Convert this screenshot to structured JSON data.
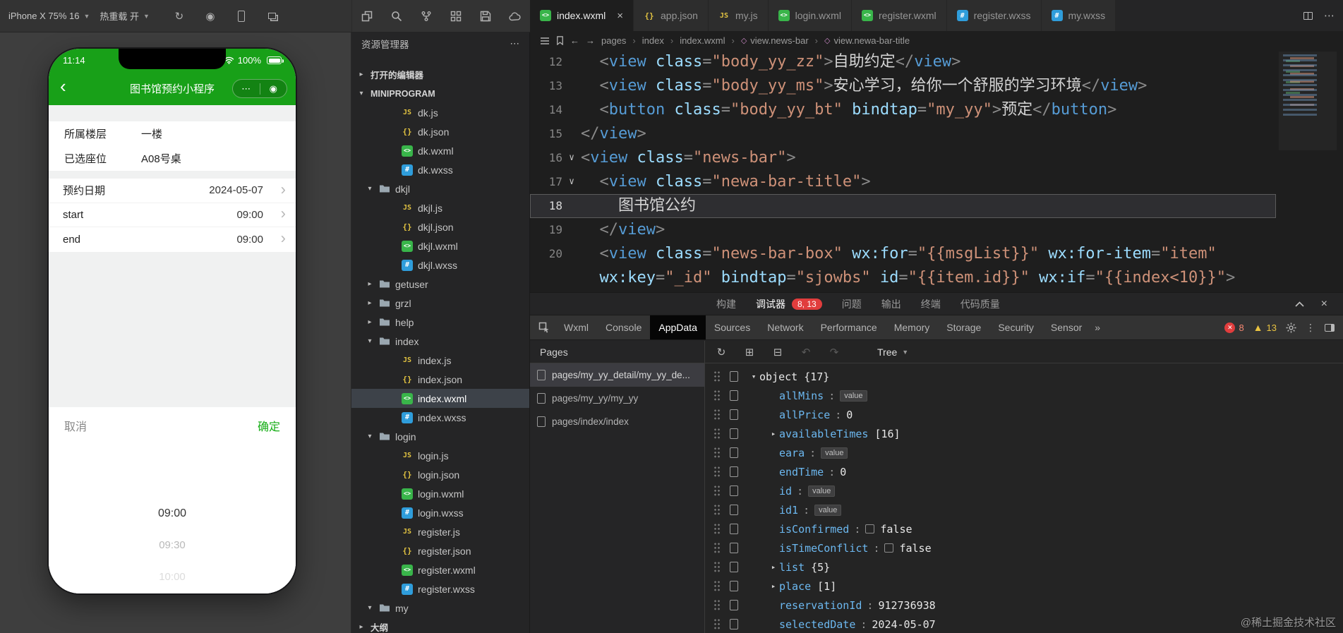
{
  "titlebar": {
    "device": "iPhone X 75% 16",
    "hot_reload": "热重载 开",
    "sim_icons": [
      "restart-icon",
      "record-icon",
      "phone-icon",
      "multi-window-icon"
    ],
    "explorer_icons": [
      "panels-icon",
      "search-icon",
      "branch-icon",
      "grid-icon",
      "save-icon",
      "cloud-icon"
    ]
  },
  "simulator": {
    "status": {
      "time": "11:14",
      "battery": "100%"
    },
    "nav_title": "图书馆预约小程序",
    "info_rows": [
      {
        "label": "所属楼层",
        "value": "一楼"
      },
      {
        "label": "已选座位",
        "value": "A08号桌"
      }
    ],
    "detail_rows": [
      {
        "label": "预约日期",
        "value": "2024-05-07"
      },
      {
        "label": "start",
        "value": "09:00"
      },
      {
        "label": "end",
        "value": "09:00"
      }
    ],
    "cancel_label": "取消",
    "confirm_label": "确定",
    "picker_options": [
      {
        "label": "09:00",
        "state": "selected"
      },
      {
        "label": "09:30",
        "state": "dim"
      },
      {
        "label": "10:00",
        "state": "faint"
      }
    ]
  },
  "explorer": {
    "title": "资源管理器",
    "items": [
      {
        "label": "打开的编辑器",
        "kind": "section",
        "arrow": "right"
      },
      {
        "label": "MINIPROGRAM",
        "kind": "section",
        "arrow": "down"
      },
      {
        "label": "dk.js",
        "kind": "js"
      },
      {
        "label": "dk.json",
        "kind": "json"
      },
      {
        "label": "dk.wxml",
        "kind": "wxml"
      },
      {
        "label": "dk.wxss",
        "kind": "wxss"
      },
      {
        "label": "dkjl",
        "kind": "folder",
        "arrow": "down"
      },
      {
        "label": "dkjl.js",
        "kind": "js"
      },
      {
        "label": "dkjl.json",
        "kind": "json"
      },
      {
        "label": "dkjl.wxml",
        "kind": "wxml"
      },
      {
        "label": "dkjl.wxss",
        "kind": "wxss"
      },
      {
        "label": "getuser",
        "kind": "folder",
        "arrow": "right"
      },
      {
        "label": "grzl",
        "kind": "folder",
        "arrow": "right"
      },
      {
        "label": "help",
        "kind": "folder",
        "arrow": "right"
      },
      {
        "label": "index",
        "kind": "folder",
        "arrow": "down"
      },
      {
        "label": "index.js",
        "kind": "js"
      },
      {
        "label": "index.json",
        "kind": "json"
      },
      {
        "label": "index.wxml",
        "kind": "wxml",
        "selected": true
      },
      {
        "label": "index.wxss",
        "kind": "wxss"
      },
      {
        "label": "login",
        "kind": "folder",
        "arrow": "down"
      },
      {
        "label": "login.js",
        "kind": "js"
      },
      {
        "label": "login.json",
        "kind": "json"
      },
      {
        "label": "login.wxml",
        "kind": "wxml"
      },
      {
        "label": "login.wxss",
        "kind": "wxss"
      },
      {
        "label": "register.js",
        "kind": "js"
      },
      {
        "label": "register.json",
        "kind": "json"
      },
      {
        "label": "register.wxml",
        "kind": "wxml"
      },
      {
        "label": "register.wxss",
        "kind": "wxss"
      },
      {
        "label": "my",
        "kind": "folder",
        "arrow": "down"
      },
      {
        "label": "大纲",
        "kind": "section",
        "arrow": "right"
      }
    ]
  },
  "editor": {
    "tabs": [
      {
        "label": "index.wxml",
        "kind": "wxml",
        "active": true
      },
      {
        "label": "app.json",
        "kind": "json"
      },
      {
        "label": "my.js",
        "kind": "js"
      },
      {
        "label": "login.wxml",
        "kind": "wxml"
      },
      {
        "label": "register.wxml",
        "kind": "wxml"
      },
      {
        "label": "register.wxss",
        "kind": "wxss"
      },
      {
        "label": "my.wxss",
        "kind": "wxss"
      }
    ],
    "breadcrumb": [
      {
        "label": "pages"
      },
      {
        "label": "index"
      },
      {
        "label": "index.wxml"
      },
      {
        "label": "view.news-bar",
        "sym": true
      },
      {
        "label": "view.newa-bar-title",
        "sym": true
      }
    ],
    "code": {
      "lines": [
        {
          "no": "12",
          "tokens": [
            {
              "c": "p",
              "t": "  <"
            },
            {
              "c": "tag",
              "t": "view"
            },
            {
              "c": "p",
              "t": " "
            },
            {
              "c": "attr",
              "t": "class"
            },
            {
              "c": "p",
              "t": "="
            },
            {
              "c": "str",
              "t": "\"body_yy_zz\""
            },
            {
              "c": "p",
              "t": ">"
            },
            {
              "c": "txt",
              "t": "自助约定"
            },
            {
              "c": "p",
              "t": "</"
            },
            {
              "c": "tag",
              "t": "view"
            },
            {
              "c": "p",
              "t": ">"
            }
          ]
        },
        {
          "no": "13",
          "tokens": [
            {
              "c": "p",
              "t": "  <"
            },
            {
              "c": "tag",
              "t": "view"
            },
            {
              "c": "p",
              "t": " "
            },
            {
              "c": "attr",
              "t": "class"
            },
            {
              "c": "p",
              "t": "="
            },
            {
              "c": "str",
              "t": "\"body_yy_ms\""
            },
            {
              "c": "p",
              "t": ">"
            },
            {
              "c": "txt",
              "t": "安心学习，给你一个舒服的学习环境"
            },
            {
              "c": "p",
              "t": "</"
            },
            {
              "c": "tag",
              "t": "view"
            },
            {
              "c": "p",
              "t": ">"
            }
          ]
        },
        {
          "no": "14",
          "tokens": [
            {
              "c": "p",
              "t": "  <"
            },
            {
              "c": "tag",
              "t": "button"
            },
            {
              "c": "p",
              "t": " "
            },
            {
              "c": "attr",
              "t": "class"
            },
            {
              "c": "p",
              "t": "="
            },
            {
              "c": "str",
              "t": "\"body_yy_bt\""
            },
            {
              "c": "p",
              "t": " "
            },
            {
              "c": "attr",
              "t": "bindtap"
            },
            {
              "c": "p",
              "t": "="
            },
            {
              "c": "str",
              "t": "\"my_yy\""
            },
            {
              "c": "p",
              "t": ">"
            },
            {
              "c": "txt",
              "t": "预定"
            },
            {
              "c": "p",
              "t": "</"
            },
            {
              "c": "tag",
              "t": "button"
            },
            {
              "c": "p",
              "t": ">"
            }
          ]
        },
        {
          "no": "15",
          "tokens": [
            {
              "c": "p",
              "t": "</"
            },
            {
              "c": "tag",
              "t": "view"
            },
            {
              "c": "p",
              "t": ">"
            }
          ]
        },
        {
          "no": "16",
          "fold": true,
          "tokens": [
            {
              "c": "p",
              "t": "<"
            },
            {
              "c": "tag",
              "t": "view"
            },
            {
              "c": "p",
              "t": " "
            },
            {
              "c": "attr",
              "t": "class"
            },
            {
              "c": "p",
              "t": "="
            },
            {
              "c": "str",
              "t": "\"news-bar\""
            },
            {
              "c": "p",
              "t": ">"
            }
          ]
        },
        {
          "no": "17",
          "fold": true,
          "tokens": [
            {
              "c": "p",
              "t": "  <"
            },
            {
              "c": "tag",
              "t": "view"
            },
            {
              "c": "p",
              "t": " "
            },
            {
              "c": "attr",
              "t": "class"
            },
            {
              "c": "p",
              "t": "="
            },
            {
              "c": "str",
              "t": "\"newa-bar-title\""
            },
            {
              "c": "p",
              "t": ">"
            }
          ]
        },
        {
          "no": "18",
          "cur": true,
          "tokens": [
            {
              "c": "txt",
              "t": "    图书馆公约"
            }
          ]
        },
        {
          "no": "19",
          "tokens": [
            {
              "c": "p",
              "t": "  </"
            },
            {
              "c": "tag",
              "t": "view"
            },
            {
              "c": "p",
              "t": ">"
            }
          ]
        },
        {
          "no": "20",
          "tokens": [
            {
              "c": "p",
              "t": "  <"
            },
            {
              "c": "tag",
              "t": "view"
            },
            {
              "c": "p",
              "t": " "
            },
            {
              "c": "attr",
              "t": "class"
            },
            {
              "c": "p",
              "t": "="
            },
            {
              "c": "str",
              "t": "\"news-bar-box\""
            },
            {
              "c": "p",
              "t": " "
            },
            {
              "c": "attr",
              "t": "wx:for"
            },
            {
              "c": "p",
              "t": "="
            },
            {
              "c": "str",
              "t": "\"{{msgList}}\""
            },
            {
              "c": "p",
              "t": " "
            },
            {
              "c": "attr",
              "t": "wx:for-item"
            },
            {
              "c": "p",
              "t": "="
            },
            {
              "c": "str",
              "t": "\"item\""
            }
          ]
        },
        {
          "no": "",
          "tokens": [
            {
              "c": "p",
              "t": "  "
            },
            {
              "c": "attr",
              "t": "wx:key"
            },
            {
              "c": "p",
              "t": "="
            },
            {
              "c": "str",
              "t": "\"_id\""
            },
            {
              "c": "p",
              "t": " "
            },
            {
              "c": "attr",
              "t": "bindtap"
            },
            {
              "c": "p",
              "t": "="
            },
            {
              "c": "str",
              "t": "\"sjowbs\""
            },
            {
              "c": "p",
              "t": " "
            },
            {
              "c": "attr",
              "t": "id"
            },
            {
              "c": "p",
              "t": "="
            },
            {
              "c": "str",
              "t": "\"{{item.id}}\""
            },
            {
              "c": "p",
              "t": " "
            },
            {
              "c": "attr",
              "t": "wx:if"
            },
            {
              "c": "p",
              "t": "="
            },
            {
              "c": "str",
              "t": "\"{{index<10}}\""
            },
            {
              "c": "p",
              "t": ">"
            }
          ]
        }
      ]
    }
  },
  "panel": {
    "tabs": [
      {
        "label": "构建"
      },
      {
        "label": "调试器",
        "active": true,
        "badge": "8, 13"
      },
      {
        "label": "问题"
      },
      {
        "label": "输出"
      },
      {
        "label": "终端"
      },
      {
        "label": "代码质量"
      }
    ],
    "devtools": {
      "tabs": [
        {
          "label": "Wxml"
        },
        {
          "label": "Console"
        },
        {
          "label": "AppData",
          "active": true
        },
        {
          "label": "Sources"
        },
        {
          "label": "Network"
        },
        {
          "label": "Performance"
        },
        {
          "label": "Memory"
        },
        {
          "label": "Storage"
        },
        {
          "label": "Security"
        },
        {
          "label": "Sensor"
        }
      ],
      "errors": "8",
      "warnings": "13"
    },
    "pages": {
      "title": "Pages",
      "items": [
        {
          "label": "pages/my_yy_detail/my_yy_de...",
          "selected": true
        },
        {
          "label": "pages/my_yy/my_yy"
        },
        {
          "label": "pages/index/index"
        }
      ]
    },
    "tree": {
      "mode": "Tree",
      "rows": [
        {
          "indent": 0,
          "arrow": "down",
          "key": "object",
          "suffix": "{17}",
          "root": true
        },
        {
          "indent": 1,
          "key": "allMins",
          "badge": "value"
        },
        {
          "indent": 1,
          "key": "allPrice",
          "value": "0"
        },
        {
          "indent": 1,
          "arrow": "right",
          "key": "availableTimes",
          "suffix": "[16]"
        },
        {
          "indent": 1,
          "key": "eara",
          "badge": "value"
        },
        {
          "indent": 1,
          "key": "endTime",
          "value": "0"
        },
        {
          "indent": 1,
          "key": "id",
          "badge": "value"
        },
        {
          "indent": 1,
          "key": "id1",
          "badge": "value"
        },
        {
          "indent": 1,
          "key": "isConfirmed",
          "checkbox": true,
          "value": "false"
        },
        {
          "indent": 1,
          "key": "isTimeConflict",
          "checkbox": true,
          "value": "false"
        },
        {
          "indent": 1,
          "arrow": "right",
          "key": "list",
          "suffix": "{5}"
        },
        {
          "indent": 1,
          "arrow": "right",
          "key": "place",
          "suffix": "[1]"
        },
        {
          "indent": 1,
          "key": "reservationId",
          "value": "912736938"
        },
        {
          "indent": 1,
          "key": "selectedDate",
          "value": "2024-05-07"
        }
      ]
    }
  },
  "watermark": "@稀土掘金技术社区"
}
